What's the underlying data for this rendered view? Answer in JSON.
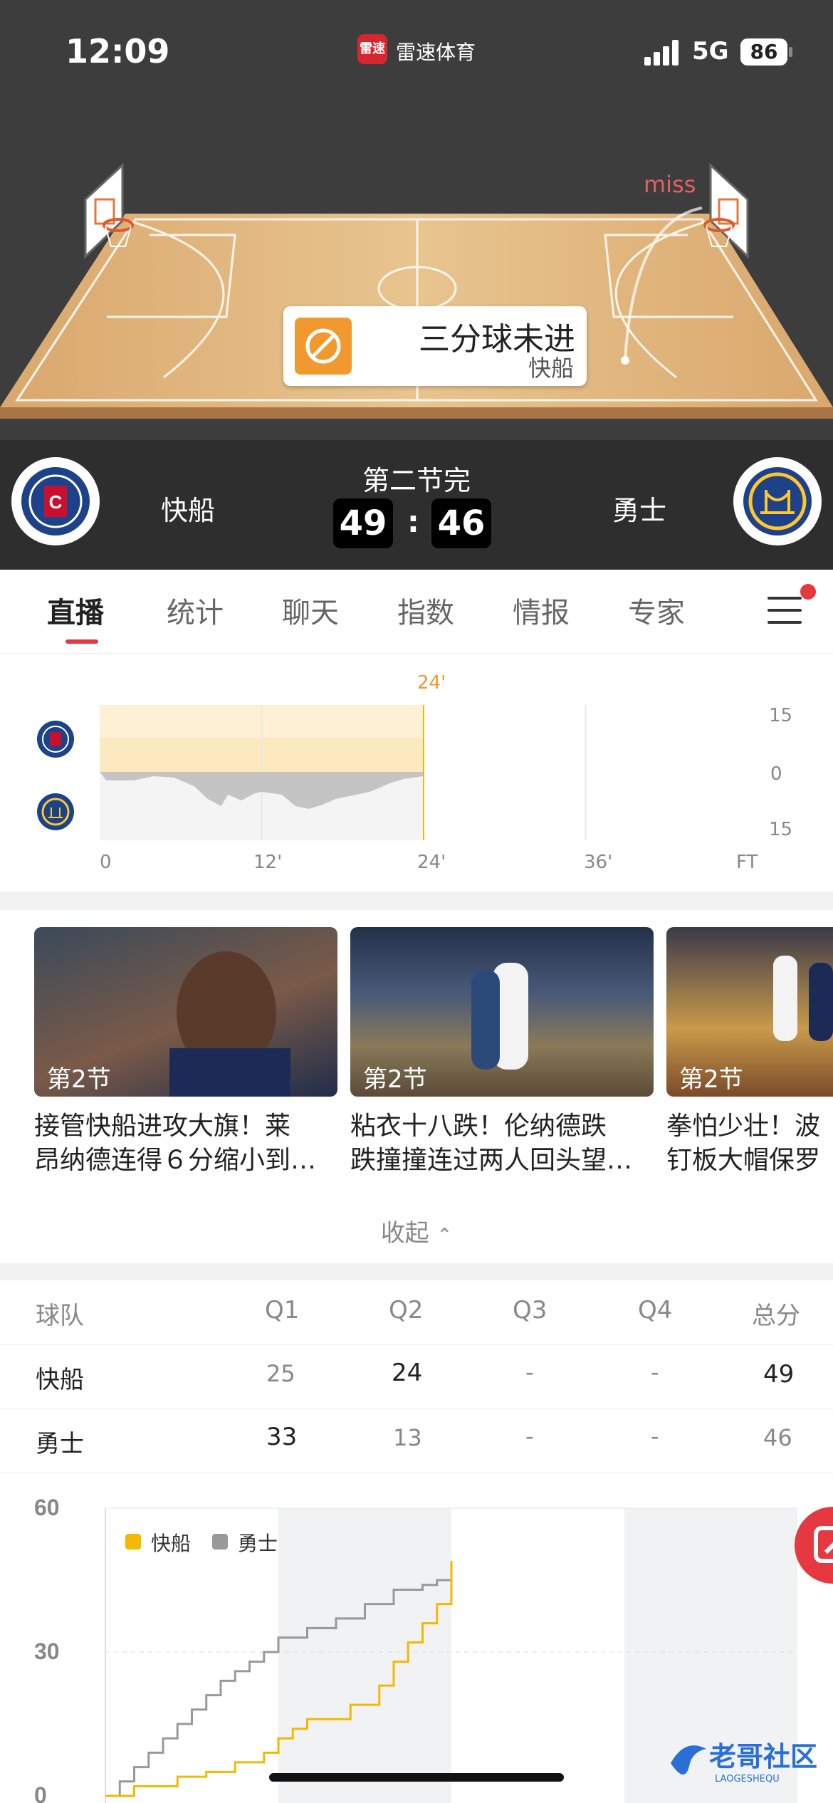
{
  "status_bar": {
    "time": "12:09",
    "app_badge": "雷速",
    "app_name": "雷速体育",
    "network": "5G",
    "battery": "86"
  },
  "court": {
    "play_title": "三分球未进",
    "play_team": "快船",
    "miss_label": "miss"
  },
  "scoreboard": {
    "period": "第二节完",
    "home": {
      "name": "快船",
      "score": "49",
      "logo": "clippers-logo"
    },
    "away": {
      "name": "勇士",
      "score": "46",
      "logo": "warriors-logo"
    },
    "separator": ":"
  },
  "tabs": [
    {
      "label": "直播",
      "active": true
    },
    {
      "label": "统计"
    },
    {
      "label": "聊天"
    },
    {
      "label": "指数"
    },
    {
      "label": "情报"
    },
    {
      "label": "专家"
    }
  ],
  "momentum_chart": {
    "current_marker": "24'",
    "x_ticks": [
      "0",
      "12'",
      "24'",
      "36'",
      "FT"
    ],
    "y_ticks": [
      "15",
      "0",
      "15"
    ],
    "progress_minutes": 24,
    "total_minutes": 48
  },
  "videos": [
    {
      "quarter": "第2节",
      "title": "接管快船进攻大旗！莱\n昂纳德连得６分缩小到…"
    },
    {
      "quarter": "第2节",
      "title": "粘衣十八跌！伦纳德跌\n跌撞撞连过两人回头望…"
    },
    {
      "quarter": "第2节",
      "title": "拳怕少壮！波\n钉板大帽保罗"
    }
  ],
  "collapse_label": "收起",
  "box_score": {
    "headers": [
      "球队",
      "Q1",
      "Q2",
      "Q3",
      "Q4",
      "总分"
    ],
    "rows": [
      {
        "team": "快船",
        "q1": "25",
        "q2": "24",
        "q3": "-",
        "q4": "-",
        "total": "49"
      },
      {
        "team": "勇士",
        "q1": "33",
        "q2": "13",
        "q3": "-",
        "q4": "-",
        "total": "46"
      }
    ]
  },
  "chart_data": {
    "type": "line",
    "y_ticks": [
      "60",
      "30",
      "0"
    ],
    "ylim": [
      0,
      60
    ],
    "xlim": [
      0,
      48
    ],
    "legend": [
      "快船",
      "勇士"
    ],
    "series": [
      {
        "name": "快船",
        "color": "#f5b800",
        "x": [
          0,
          2,
          3,
          5,
          7,
          9,
          11,
          12,
          13,
          14,
          16,
          17,
          19,
          20,
          21,
          22,
          23,
          24
        ],
        "y": [
          0,
          2,
          2,
          4,
          5,
          7,
          9,
          12,
          14,
          16,
          16,
          19,
          23,
          28,
          32,
          36,
          40,
          49
        ]
      },
      {
        "name": "勇士",
        "color": "#999999",
        "x": [
          0,
          1,
          2,
          3,
          4,
          5,
          6,
          7,
          8,
          9,
          10,
          11,
          12,
          14,
          16,
          18,
          20,
          22,
          23,
          24
        ],
        "y": [
          0,
          3,
          6,
          9,
          12,
          15,
          18,
          21,
          24,
          26,
          28,
          30,
          33,
          35,
          37,
          40,
          43,
          44,
          45,
          46
        ]
      }
    ],
    "colors": {
      "home": "#f5b800",
      "away": "#999999",
      "shade": "#f1f2f4"
    }
  }
}
